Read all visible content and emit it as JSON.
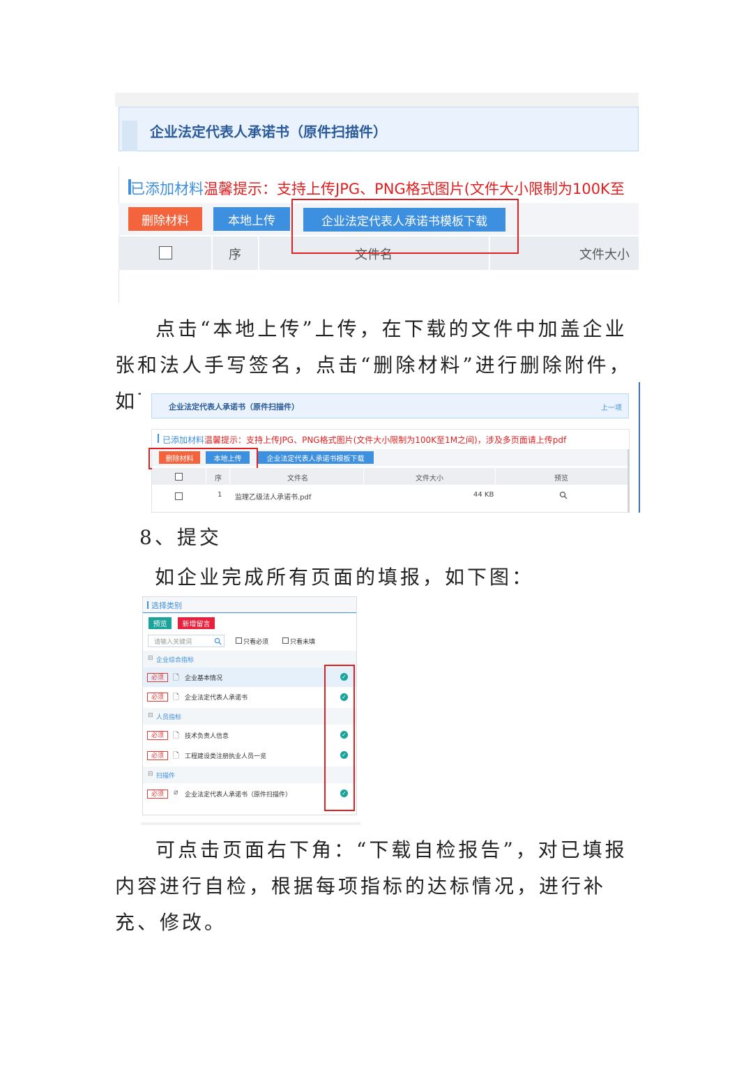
{
  "shot1": {
    "title": "企业法定代表人承诺书（原件扫描件）",
    "added_label": "已添加材料",
    "notice": "温馨提示：支持上传JPG、PNG格式图片(文件大小限制为100K至",
    "delete_btn": "删除材料",
    "upload_btn": "本地上传",
    "template_btn": "企业法定代表人承诺书模板下载",
    "col_seq": "序",
    "col_filename": "文件名",
    "col_filesize": "文件大小"
  },
  "para1": "点击“本地上传”上传，在下载的文件中加盖企业张和法人手写签名，点击“删除材料”进行删除附件，如下图：",
  "shot2": {
    "title": "企业法定代表人承诺书（原件扫描件）",
    "prev": "上一项",
    "added_label": "已添加材料",
    "notice": "温馨提示：支持上传JPG、PNG格式图片(文件大小限制为100K至1M之间)，涉及多页面请上传pdf",
    "delete_btn": "删除材料",
    "upload_btn": "本地上传",
    "template_btn": "企业法定代表人承诺书模板下载",
    "col_seq": "序",
    "col_filename": "文件名",
    "col_filesize": "文件大小",
    "col_preview": "预览",
    "row": {
      "seq": "1",
      "filename": "监理乙级法人承诺书.pdf",
      "size": "44 KB"
    }
  },
  "heading": "8、提交",
  "para2": "如企业完成所有页面的填报，如下图：",
  "shot3": {
    "title": "选择类别",
    "preview_btn": "预览",
    "new_btn": "新增留言",
    "search_placeholder": "请输入关键词",
    "only_required": "只看必须",
    "only_unfilled": "只看未填",
    "required_tag": "必须",
    "groups": [
      "企业综合指标",
      "人员指标",
      "扫描件"
    ],
    "items": [
      "企业基本情况",
      "企业法定代表人承诺书",
      "技术负责人信息",
      "工程建设类注册执业人员一览",
      "企业法定代表人承诺书（原件扫描件）"
    ]
  },
  "para3": "可点击页面右下角：“下载自检报告”，对已填报内容进行自检，根据每项指标的达标情况，进行补充、修改。",
  "colors": {
    "orange": "#f4643c",
    "blue": "#3d8fe0",
    "red_text": "#e02020",
    "teal": "#1aa39a",
    "new_red": "#e8203c"
  }
}
